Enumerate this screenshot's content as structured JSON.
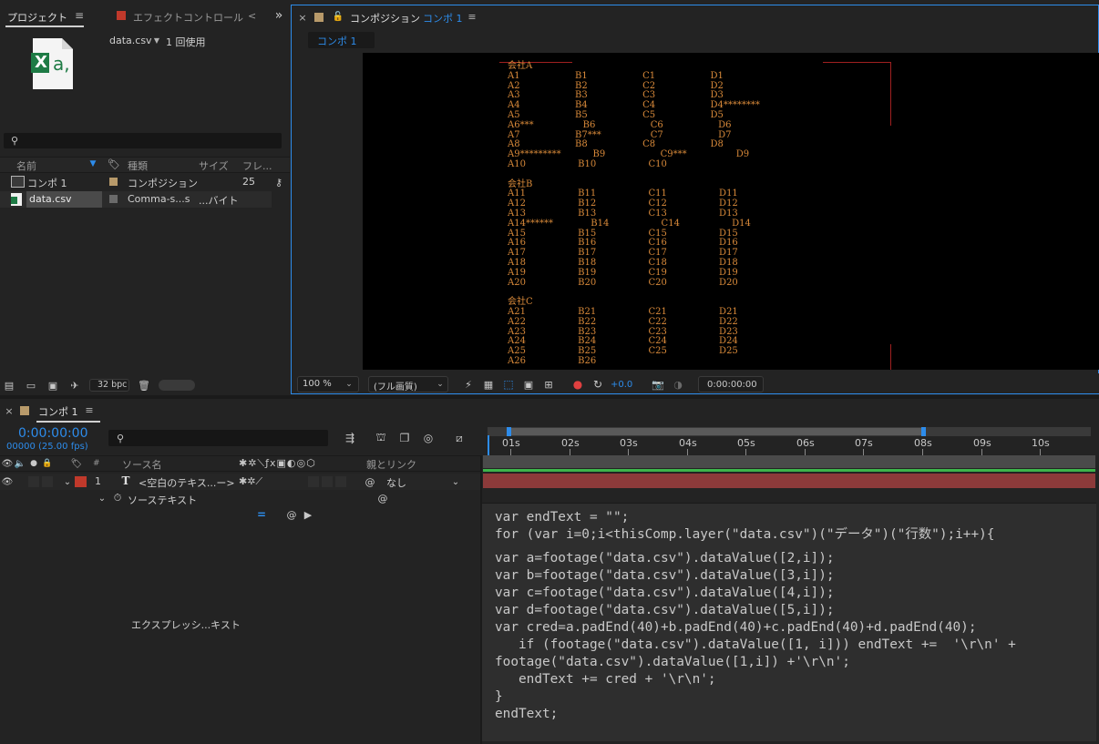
{
  "project_panel": {
    "tab_project": "プロジェクト",
    "tab_effects": "エフェクトコントロール",
    "tab_effects_suffix": "<",
    "file_name": "data.csv",
    "usage": "1 回使用",
    "icon_letters": "X",
    "icon_letters2": "a,",
    "columns": [
      "名前",
      "種類",
      "サイズ",
      "フレ..."
    ],
    "items": [
      {
        "name": "コンポ 1",
        "type": "コンポジション",
        "size": "25"
      },
      {
        "name": "data.csv",
        "type": "Comma-s...s",
        "size": "...バイト"
      }
    ],
    "bpc": "32 bpc"
  },
  "comp_panel": {
    "tab_label": "コンポジション",
    "comp_name": "コンポ 1",
    "subtab": "コンポ 1",
    "zoom": "100 %",
    "quality": "(フル画質)",
    "exposure": "+0.0",
    "timecode": "0:00:00:00"
  },
  "viewer_text": [
    "会社A",
    "A1                   B1                   C1                   D1",
    "A2                   B2                   C2                   D2",
    "A3                   B3                   C3                   D3",
    "A4                   B4                   C4                   D4********",
    "A5                   B5                   C5                   D5",
    "A6***                 B6                   C6                   D6",
    "A7                   B7***                 C7                   D7",
    "A8                   B8                   C8                   D8",
    "A9*********           B9                   C9***                 D9",
    "A10                  B10                  C10",
    "",
    "会社B",
    "A11                  B11                  C11                  D11",
    "A12                  B12                  C12                  D12",
    "A13                  B13                  C13                  D13",
    "A14******             B14                  C14                  D14",
    "A15                  B15                  C15                  D15",
    "A16                  B16                  C16                  D16",
    "A17                  B17                  C17                  D17",
    "A18                  B18                  C18                  D18",
    "A19                  B19                  C19                  D19",
    "A20                  B20                  C20                  D20",
    "",
    "会社C",
    "A21                  B21                  C21                  D21",
    "A22                  B22                  C22                  D22",
    "A23                  B23                  C23                  D23",
    "A24                  B24                  C24                  D24",
    "A25                  B25                  C25                  D25",
    "A26                  B26"
  ],
  "timeline": {
    "tab": "コンポ 1",
    "timecode": "0:00:00:00",
    "frames": "00000 (25.00 fps)",
    "col_hash": "#",
    "col_source": "ソース名",
    "col_parent": "親とリンク",
    "layer_num": "1",
    "layer_name": "<空白のテキス...ー>",
    "parent_value": "なし",
    "property": "ソーステキスト",
    "expression_label": "エクスプレッシ...キスト",
    "ticks": [
      "01s",
      "02s",
      "03s",
      "04s",
      "05s",
      "06s",
      "07s",
      "08s",
      "09s",
      "10s"
    ]
  },
  "expression_code": [
    "var endText = \"\";",
    "for (var i=0;i<thisComp.layer(\"data.csv\")(\"データ\")(\"行数\");i++){",
    "var a=footage(\"data.csv\").dataValue([2,i]);",
    "var b=footage(\"data.csv\").dataValue([3,i]);",
    "var c=footage(\"data.csv\").dataValue([4,i]);",
    "var d=footage(\"data.csv\").dataValue([5,i]);",
    "var cred=a.padEnd(40)+b.padEnd(40)+c.padEnd(40)+d.padEnd(40);",
    "   if (footage(\"data.csv\").dataValue([1, i])) endText +=  '\\r\\n' +",
    "footage(\"data.csv\").dataValue([1,i]) +'\\r\\n';",
    "   endText += cred + '\\r\\n';",
    "}",
    "endText;"
  ],
  "colors": {
    "accent": "#2d8ceb",
    "text_orange": "#d98a3a",
    "layer_red": "#8c3a3a",
    "green_bar": "#3cb44b"
  }
}
